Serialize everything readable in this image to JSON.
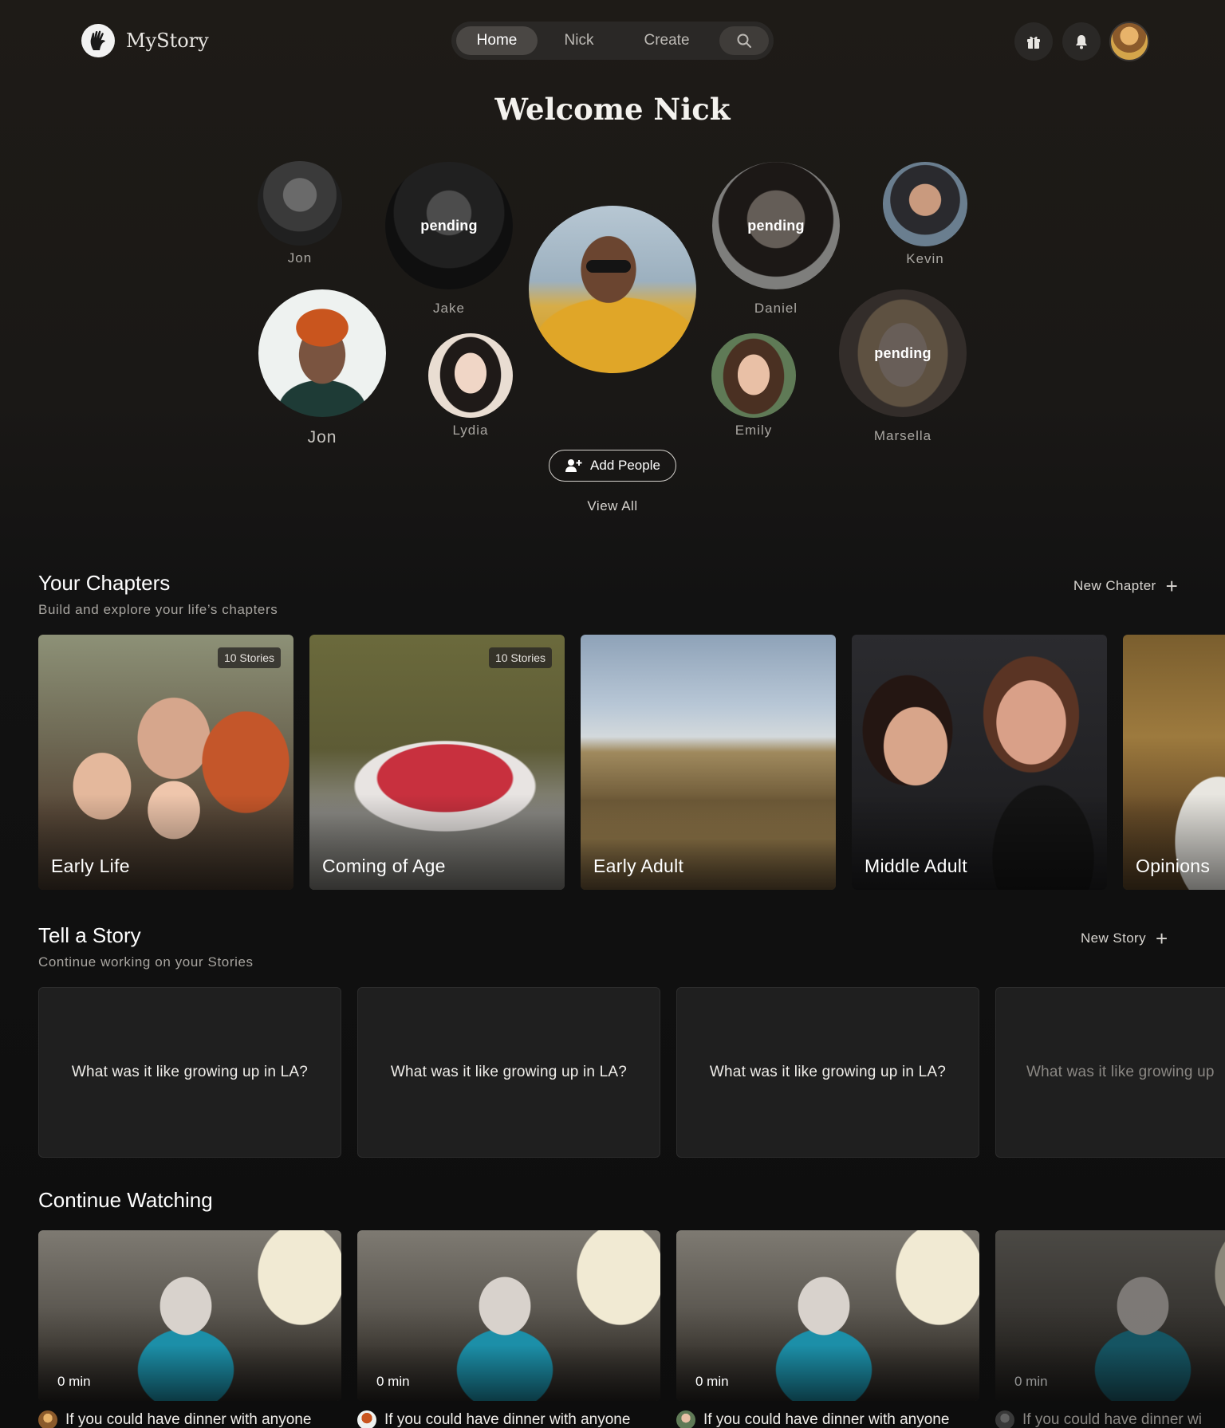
{
  "app": {
    "name": "MyStory"
  },
  "nav": {
    "tabs": [
      {
        "label": "Home",
        "active": true
      },
      {
        "label": "Nick",
        "active": false
      },
      {
        "label": "Create",
        "active": false
      }
    ],
    "search_icon": "search-icon"
  },
  "header_icons": [
    "gift-icon",
    "bell-icon"
  ],
  "welcome": "Welcome Nick",
  "people": [
    {
      "name": "Jon",
      "status": ""
    },
    {
      "name": "Jake",
      "status": "pending"
    },
    {
      "name": "Daniel",
      "status": "pending"
    },
    {
      "name": "Kevin",
      "status": ""
    },
    {
      "name": "Jon",
      "status": ""
    },
    {
      "name": "Lydia",
      "status": ""
    },
    {
      "name": "Emily",
      "status": ""
    },
    {
      "name": "Marsella",
      "status": "pending"
    }
  ],
  "add_people_label": "Add People",
  "view_all_label": "View All",
  "chapters": {
    "title": "Your Chapters",
    "subtitle": "Build and explore your life’s chapters",
    "action": "New Chapter",
    "items": [
      {
        "label": "Early Life",
        "badge": "10 Stories"
      },
      {
        "label": "Coming of Age",
        "badge": "10 Stories"
      },
      {
        "label": "Early Adult",
        "badge": ""
      },
      {
        "label": "Middle Adult",
        "badge": ""
      },
      {
        "label": "Opinions",
        "badge": ""
      }
    ]
  },
  "stories": {
    "title": "Tell a Story",
    "subtitle": "Continue working on your Stories",
    "action": "New Story",
    "items": [
      "What was it like growing up in LA?",
      "What was it like growing up in LA?",
      "What was it like growing up in LA?",
      "What was it like growing up"
    ]
  },
  "watching": {
    "title": "Continue Watching",
    "items": [
      {
        "duration": "0 min",
        "title": "If you could have dinner with anyone"
      },
      {
        "duration": "0 min",
        "title": "If you could have dinner with anyone"
      },
      {
        "duration": "0 min",
        "title": "If you could have dinner with anyone"
      },
      {
        "duration": "0 min",
        "title": "If you could have dinner wi"
      }
    ]
  },
  "colors": {
    "background": "#121212",
    "nav_pill": "#2a2826",
    "nav_active": "#4a4744",
    "card": "#1f1f1f"
  }
}
